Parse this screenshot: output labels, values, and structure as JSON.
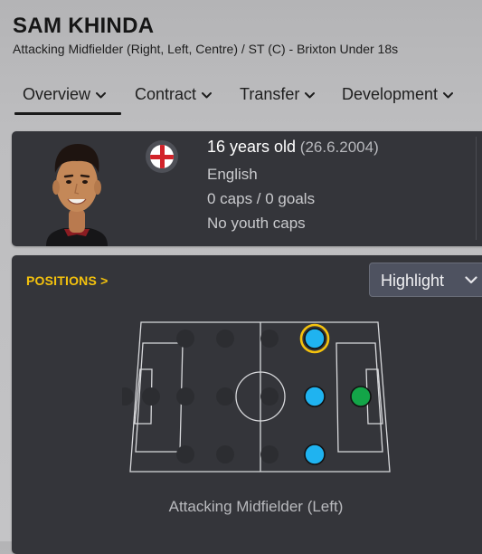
{
  "player": {
    "name": "SAM KHINDA",
    "subtitle": "Attacking Midfielder (Right, Left, Centre) / ST (C) - Brixton Under 18s"
  },
  "tabs": [
    {
      "label": "Overview",
      "active": true
    },
    {
      "label": "Contract",
      "active": false
    },
    {
      "label": "Transfer",
      "active": false
    },
    {
      "label": "Development",
      "active": false
    }
  ],
  "bio": {
    "age": "16 years old",
    "dob": "(26.6.2004)",
    "nationality": "English",
    "caps": "0 caps / 0 goals",
    "youth_caps": "No youth caps",
    "flag_icon": "england-flag-icon"
  },
  "positions": {
    "header": "POSITIONS",
    "header_chevron": ">",
    "highlight_label": "Highlight",
    "selected_position": "Attacking Midfielder (Left)",
    "colors": {
      "natural": "#1fb3f0",
      "accomplished": "#13a548",
      "selected_ring": "#f4c20d",
      "inactive": "#2c2d31",
      "header": "#f4c20d"
    }
  }
}
